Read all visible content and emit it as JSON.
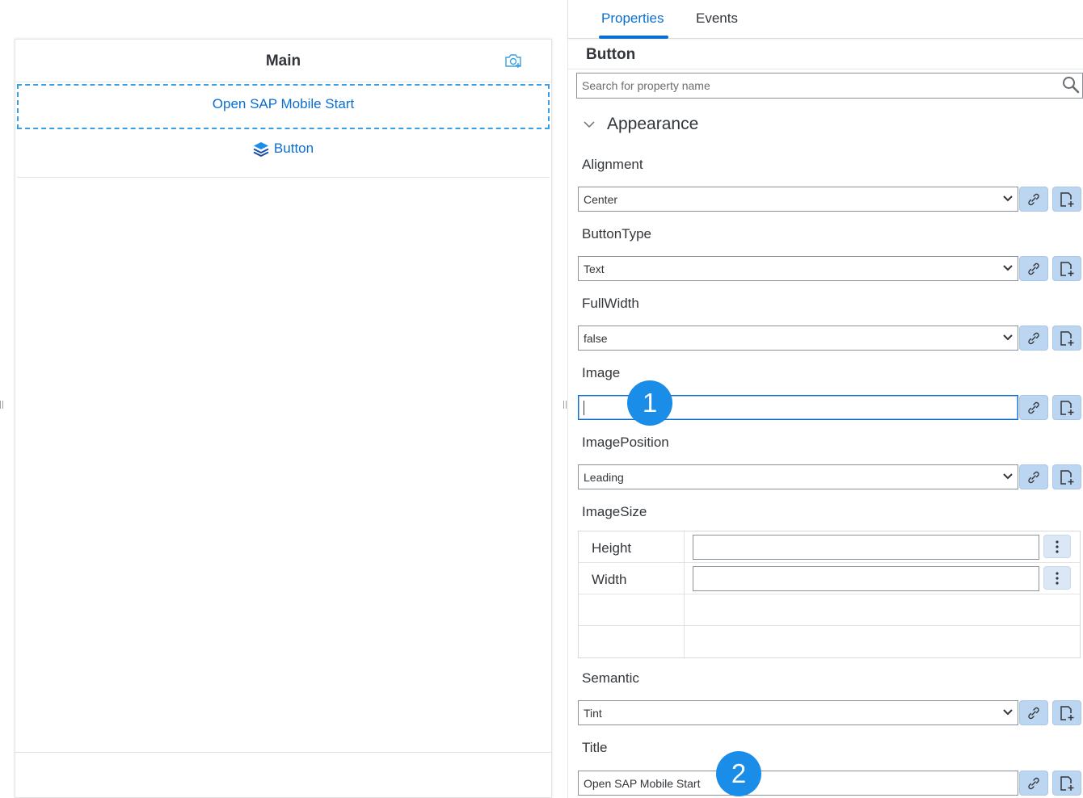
{
  "canvas": {
    "page_title": "Main",
    "selected_button_label": "Open SAP Mobile Start",
    "button_label": "Button"
  },
  "panel": {
    "tabs": [
      {
        "label": "Properties",
        "active": true
      },
      {
        "label": "Events",
        "active": false
      }
    ],
    "control_type": "Button",
    "search_placeholder": "Search for property name",
    "group_title": "Appearance",
    "properties": {
      "alignment": {
        "label": "Alignment",
        "value": "Center"
      },
      "button_type": {
        "label": "ButtonType",
        "value": "Text"
      },
      "full_width": {
        "label": "FullWidth",
        "value": "false"
      },
      "image": {
        "label": "Image",
        "value": ""
      },
      "image_position": {
        "label": "ImagePosition",
        "value": "Leading"
      },
      "image_size": {
        "label": "ImageSize",
        "rows": [
          {
            "label": "Height",
            "value": ""
          },
          {
            "label": "Width",
            "value": ""
          }
        ]
      },
      "semantic": {
        "label": "Semantic",
        "value": "Tint"
      },
      "title": {
        "label": "Title",
        "value": "Open SAP Mobile Start"
      }
    }
  },
  "callouts": [
    "1",
    "2"
  ],
  "colors": {
    "accent": "#0a6ed1",
    "badge": "#1a8de8",
    "icon_button_bg": "#bcd5f1"
  }
}
